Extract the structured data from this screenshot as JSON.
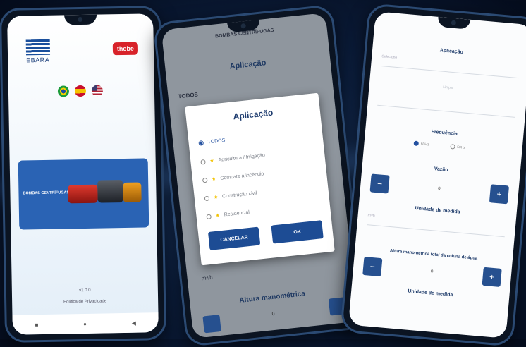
{
  "phone1": {
    "brand_left": "EBARA",
    "brand_right": "thebe",
    "banner_label": "BOMBAS CENTRÍFUGAS",
    "version": "v1.0.0",
    "privacy": "Política de Privacidade",
    "nav": [
      "■",
      "●",
      "◀"
    ]
  },
  "phone2": {
    "top_title": "BOMBAS CENTRÍFUGAS",
    "section_title": "Aplicação",
    "selected": "TODOS",
    "unit": "m³/h",
    "altura_title": "Altura manométrica",
    "altura_value": "0",
    "modal": {
      "title": "Aplicação",
      "options": [
        "TODOS",
        "Agricultura / Irrigação",
        "Combate a incêndio",
        "Construção civil",
        "Residencial"
      ],
      "cancel": "CANCELAR",
      "ok": "OK"
    }
  },
  "phone3": {
    "aplicacao": "Aplicação",
    "aplicacao_value": "Selecione",
    "limpar": "Limpar",
    "frequencia": "Frequência",
    "freq_options": [
      "60Hz",
      "50Hz"
    ],
    "vazao": "Vazão",
    "vazao_value": "0",
    "unidade1": "Unidade de medida",
    "unidade1_value": "m³/h",
    "altura": "Altura manométrica total da coluna de água",
    "altura_value": "0",
    "unidade2": "Unidade de medida"
  },
  "colors": {
    "primary": "#1d4c94",
    "accent_red": "#d8232a",
    "star": "#f2c200"
  }
}
